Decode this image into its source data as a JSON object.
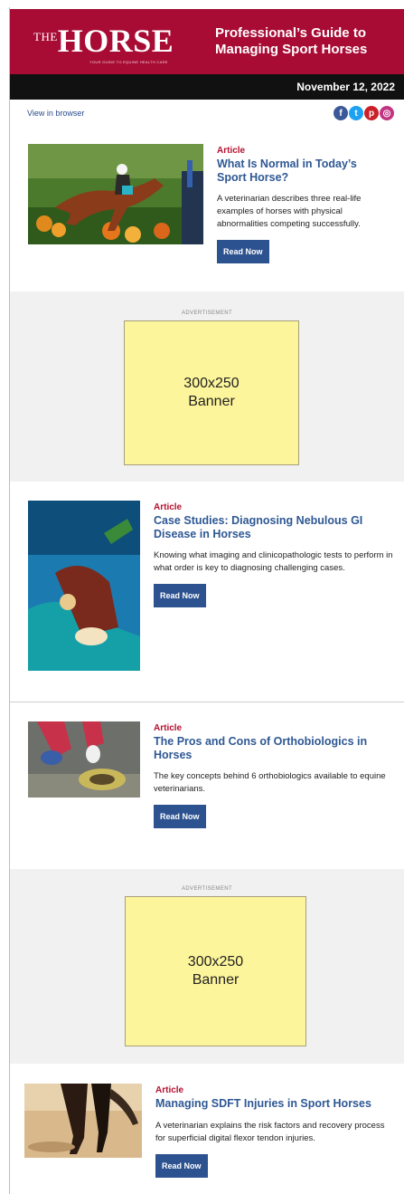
{
  "header": {
    "logo_the": "THE",
    "logo_horse": "HORSE",
    "logo_tagline": "YOUR GUIDE TO EQUINE HEALTH CARE",
    "title": "Professional’s Guide to Managing Sport Horses",
    "date": "November 12, 2022"
  },
  "toolbar": {
    "view_in_browser": "View in browser",
    "social": [
      {
        "icon": "facebook-icon",
        "glyph": "f",
        "color": "#3b5998"
      },
      {
        "icon": "twitter-icon",
        "glyph": "t",
        "color": "#1da1f2"
      },
      {
        "icon": "pinterest-icon",
        "glyph": "p",
        "color": "#cb2027"
      },
      {
        "icon": "instagram-icon",
        "glyph": "◎",
        "color": "#c13584"
      }
    ]
  },
  "articles": [
    {
      "kicker": "Article",
      "title": "What Is Normal in Today’s Sport Horse?",
      "summary": "A veterinarian describes three real-life examples of horses with physical abnormalities competing successfully.",
      "button": "Read Now"
    },
    {
      "kicker": "Article",
      "title": "Case Studies: Diagnosing Nebulous GI Disease in Horses",
      "summary": "Knowing what imaging and clinicopathologic tests to perform in what order is key to diagnosing challenging cases.",
      "button": "Read Now"
    },
    {
      "kicker": "Article",
      "title": "The Pros and Cons of Orthobiologics in Horses",
      "summary": "The key concepts behind 6 orthobiologics available to equine veterinarians.",
      "button": "Read Now"
    },
    {
      "kicker": "Article",
      "title": "Managing SDFT Injuries in Sport Horses",
      "summary": "A veterinarian explains the risk factors and recovery process for superficial digital flexor tendon injuries.",
      "button": "Read Now"
    }
  ],
  "ads": [
    {
      "label": "ADVERTISEMENT",
      "size": "300x250",
      "name": "Banner"
    },
    {
      "label": "ADVERTISEMENT",
      "size": "300x250",
      "name": "Banner"
    }
  ],
  "colors": {
    "brand": "#a80b34",
    "link": "#2e5894",
    "kicker": "#b5112f",
    "button": "#2c5290",
    "banner": "#fdf59c"
  }
}
